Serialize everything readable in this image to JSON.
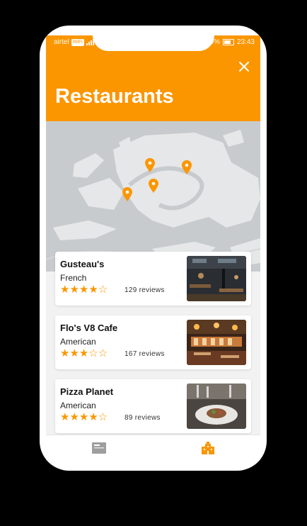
{
  "status": {
    "carrier": "airtel",
    "wifi": "WiFi",
    "battery_pct": "0%",
    "time": "23:43"
  },
  "header": {
    "title": "Restaurants"
  },
  "colors": {
    "accent": "#fb9600",
    "map_water": "#c8cbcd",
    "map_land": "#e6e7e8"
  },
  "restaurants": [
    {
      "name": "Gusteau's",
      "cuisine": "French",
      "stars": "★★★★☆",
      "reviews": "129 reviews",
      "image": "dark-industrial-dining-room"
    },
    {
      "name": "Flo's V8 Cafe",
      "cuisine": "American",
      "stars": "★★★☆☆",
      "reviews": "167 reviews",
      "image": "warm-lit-bistro-interior"
    },
    {
      "name": "Pizza Planet",
      "cuisine": "American",
      "stars": "★★★★☆",
      "reviews": "89 reviews",
      "image": "plated-dish-table-setting"
    }
  ],
  "nav": {
    "items": [
      "article-icon",
      "restaurant-building-icon"
    ]
  }
}
